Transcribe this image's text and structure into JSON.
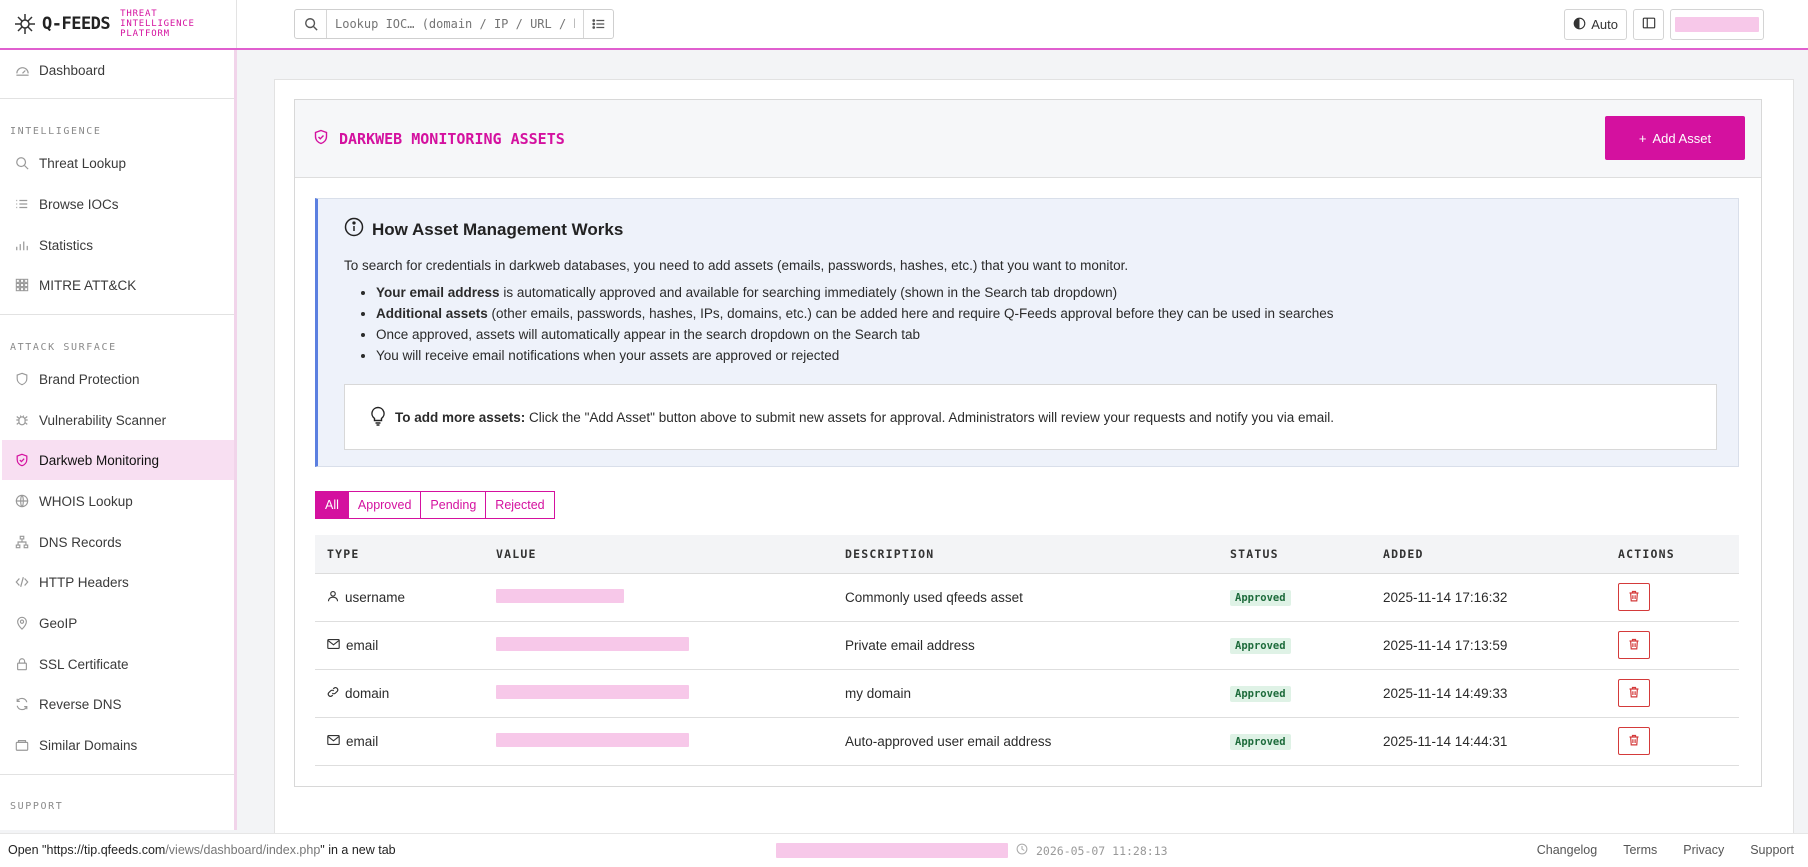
{
  "brand": {
    "name": "Q-FEEDS",
    "tagline_lines": [
      "THREAT",
      "INTELLIGENCE",
      "PLATFORM"
    ]
  },
  "search": {
    "placeholder": "Lookup IOC… (domain / IP / URL / hash)"
  },
  "topbar": {
    "theme_label": "Auto"
  },
  "sidebar": {
    "dashboard": "Dashboard",
    "sections": {
      "intelligence": "INTELLIGENCE",
      "attack_surface": "ATTACK SURFACE",
      "support": "SUPPORT"
    },
    "intelligence_items": [
      "Threat Lookup",
      "Browse IOCs",
      "Statistics",
      "MITRE ATT&CK"
    ],
    "attack_items": [
      "Brand Protection",
      "Vulnerability Scanner",
      "Darkweb Monitoring",
      "WHOIS Lookup",
      "DNS Records",
      "HTTP Headers",
      "GeoIP",
      "SSL Certificate",
      "Reverse DNS",
      "Similar Domains"
    ],
    "active": "Darkweb Monitoring"
  },
  "card": {
    "title": "DARKWEB MONITORING ASSETS",
    "add_button": "Add Asset"
  },
  "info": {
    "heading": "How Asset Management Works",
    "intro": "To search for credentials in darkweb databases, you need to add assets (emails, passwords, hashes, etc.) that you want to monitor.",
    "bullets": [
      {
        "bold": "Your email address",
        "text": " is automatically approved and available for searching immediately (shown in the Search tab dropdown)"
      },
      {
        "bold": "Additional assets",
        "text": " (other emails, passwords, hashes, IPs, domains, etc.) can be added here and require Q-Feeds approval before they can be used in searches"
      },
      {
        "bold": "",
        "text": "Once approved, assets will automatically appear in the search dropdown on the Search tab"
      },
      {
        "bold": "",
        "text": "You will receive email notifications when your assets are approved or rejected"
      }
    ],
    "tip_bold": "To add more assets:",
    "tip_text": " Click the \"Add Asset\" button above to submit new assets for approval. Administrators will review your requests and notify you via email."
  },
  "filters": [
    "All",
    "Approved",
    "Pending",
    "Rejected"
  ],
  "active_filter": "All",
  "table": {
    "headers": [
      "TYPE",
      "VALUE",
      "DESCRIPTION",
      "STATUS",
      "ADDED",
      "ACTIONS"
    ],
    "rows": [
      {
        "type": "username",
        "icon": "user-icon",
        "description": "Commonly used qfeeds asset",
        "status": "Approved",
        "added": "2025-11-14 17:16:32"
      },
      {
        "type": "email",
        "icon": "envelope-icon",
        "description": "Private email address",
        "status": "Approved",
        "added": "2025-11-14 17:13:59"
      },
      {
        "type": "domain",
        "icon": "link-icon",
        "description": "my domain",
        "status": "Approved",
        "added": "2025-11-14 14:49:33"
      },
      {
        "type": "email",
        "icon": "envelope-icon",
        "description": "Auto-approved user email address",
        "status": "Approved",
        "added": "2025-11-14 14:44:31"
      }
    ]
  },
  "statusbar": {
    "link_prefix": "Open \"",
    "link_host": "https://tip.qfeeds.com",
    "link_path": "/views/dashboard/index.php",
    "link_suffix": "\" in a new tab",
    "timestamp": "2026-05-07 11:28:13",
    "links": [
      "Changelog",
      "Terms",
      "Privacy",
      "Support"
    ]
  },
  "colors": {
    "accent": "#d4119f",
    "info_border": "#5b7fe0",
    "approved_bg": "#dff2e6",
    "danger": "#d43a3a"
  }
}
